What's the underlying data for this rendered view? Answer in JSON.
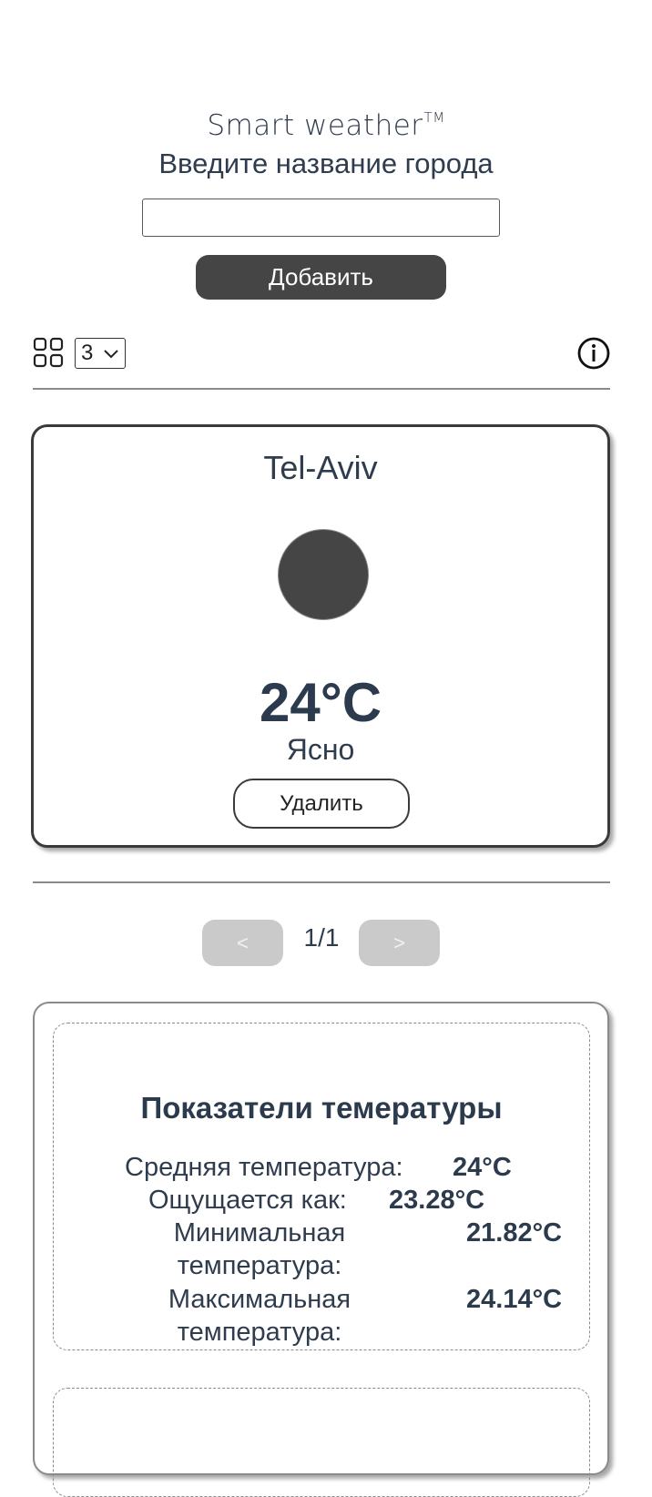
{
  "header": {
    "brand": "Smart weather",
    "trademark": "TM",
    "prompt": "Введите название города"
  },
  "search": {
    "value": "",
    "placeholder": "",
    "add_label": "Добавить"
  },
  "toolbar": {
    "layout_icon": "grid-icon",
    "per_page_value": "3",
    "info_icon": "info-icon"
  },
  "cards": [
    {
      "city": "Tel-Aviv",
      "icon": "weather-circle-icon",
      "temperature": "24°C",
      "condition": "Ясно",
      "delete_label": "Удалить"
    }
  ],
  "pagination": {
    "prev_label": "<",
    "next_label": ">",
    "page_indicator": "1/1"
  },
  "stats": {
    "title": "Показатели темературы",
    "items": [
      {
        "label": "Средняя температура:",
        "value": "24°C"
      },
      {
        "label": "Ощущается как:",
        "value": "23.28°C"
      },
      {
        "label": "Минимальная температура:",
        "value": "21.82°C"
      },
      {
        "label": "Максимальная температура:",
        "value": "24.14°C"
      }
    ]
  },
  "colors": {
    "text": "#2c3a4d",
    "button_dark": "#454545",
    "button_disabled": "#cacaca",
    "border": "#3a3a3a"
  }
}
